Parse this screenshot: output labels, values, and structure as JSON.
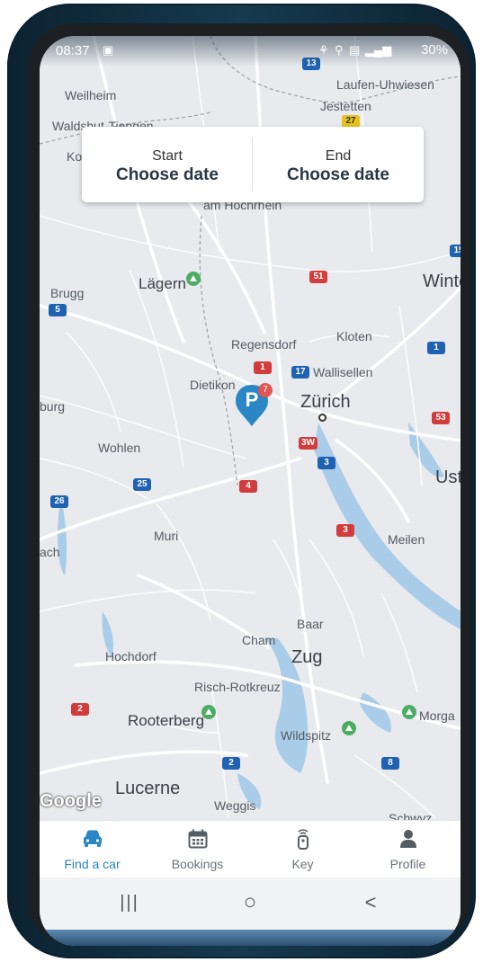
{
  "status_bar": {
    "time": "08:37",
    "battery": "30%"
  },
  "date_picker": {
    "start_label": "Start",
    "start_value": "Choose date",
    "end_label": "End",
    "end_value": "Choose date"
  },
  "map": {
    "places": {
      "weilheim": "Weilheim",
      "waldshut": "Waldshut-Tiengen",
      "laufen": "Laufen-Uhwiesen",
      "jestetten": "Jestetten",
      "am_hochrhein": "am Hochrhein",
      "ko": "Ko",
      "brugg": "Brugg",
      "lagern": "Lägern",
      "winte": "Winte",
      "regensdorf": "Regensdorf",
      "kloten": "Kloten",
      "dietikon": "Dietikon",
      "wallisellen": "Wallisellen",
      "zurich": "Zürich",
      "burg": "burg",
      "wohlen": "Wohlen",
      "ust": "Ust",
      "muri": "Muri",
      "ach": "ach",
      "meilen": "Meilen",
      "baar": "Baar",
      "cham": "Cham",
      "zug": "Zug",
      "hochdorf": "Hochdorf",
      "risch": "Risch-Rotkreuz",
      "rooterberg": "Rooterberg",
      "wildspitz": "Wildspitz",
      "morga": "Morga",
      "lucerne": "Lucerne",
      "weggis": "Weggis",
      "schwyz": "Schwyz"
    },
    "road_signs": [
      "13",
      "27",
      "15",
      "51",
      "5",
      "1",
      "17",
      "53",
      "3W",
      "3",
      "25",
      "4",
      "26",
      "3",
      "2",
      "2",
      "8",
      "1"
    ],
    "attribution": "Google",
    "parking_marker": {
      "symbol": "P",
      "count": "7",
      "color": "#2a86c4",
      "badge_color": "#e25555"
    }
  },
  "bottom_nav": {
    "items": [
      {
        "label": "Find a car",
        "icon": "car-icon"
      },
      {
        "label": "Bookings",
        "icon": "calendar-icon"
      },
      {
        "label": "Key",
        "icon": "key-fob-icon"
      },
      {
        "label": "Profile",
        "icon": "person-icon"
      }
    ],
    "active_color": "#2a86c4"
  },
  "system_nav": {
    "recent": "|||",
    "home": "○",
    "back": "<"
  }
}
